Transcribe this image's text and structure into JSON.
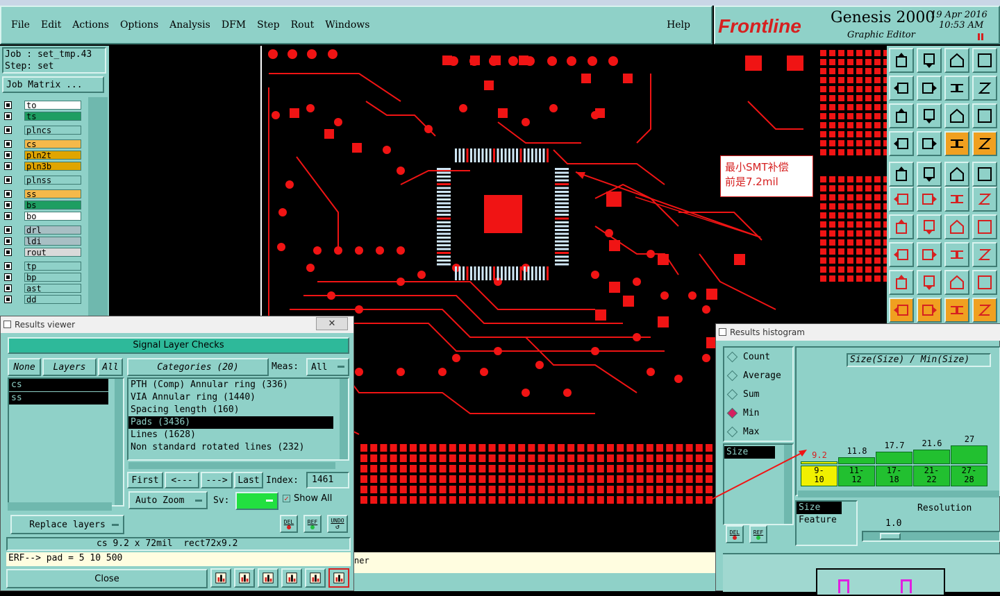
{
  "menubar": {
    "items": [
      "File",
      "Edit",
      "Actions",
      "Options",
      "Analysis",
      "DFM",
      "Step",
      "Rout",
      "Windows"
    ],
    "help": "Help"
  },
  "brand": {
    "logo": "Frontline",
    "product": "Genesis 2000",
    "subtitle": "Graphic Editor",
    "date": "19 Apr 2016",
    "time": "10:53  AM"
  },
  "job": {
    "job_label": "Job : set_tmp.43",
    "step_label": "Step: set",
    "matrix_button": "Job Matrix ..."
  },
  "layers": [
    {
      "name": "to",
      "color": "#ffffff"
    },
    {
      "name": "ts",
      "color": "#1e9e62"
    },
    {
      "name": "plncs",
      "color": "#8fd1c8"
    },
    {
      "name": "cs",
      "color": "#f5b94a"
    },
    {
      "name": "pln2t",
      "color": "#e0a500"
    },
    {
      "name": "pln3b",
      "color": "#e0a500"
    },
    {
      "name": "plnss",
      "color": "#8fd1c8"
    },
    {
      "name": "ss",
      "color": "#f5b94a"
    },
    {
      "name": "bs",
      "color": "#1e9e62"
    },
    {
      "name": "bo",
      "color": "#ffffff"
    },
    {
      "name": "drl",
      "color": "#a8bfc4"
    },
    {
      "name": "ldi",
      "color": "#a8bfc4"
    },
    {
      "name": "rout",
      "color": "#d9d9d9"
    },
    {
      "name": "tp",
      "color": "#8fd1c8"
    },
    {
      "name": "bp",
      "color": "#8fd1c8"
    },
    {
      "name": "ast",
      "color": "#8fd1c8"
    },
    {
      "name": "dd",
      "color": "#8fd1c8"
    }
  ],
  "annotation": {
    "line1": "最小SMT补偿",
    "line2": "前是7.2mil"
  },
  "results_viewer": {
    "title": "Results viewer",
    "header": "Signal Layer Checks",
    "none_btn": "None",
    "layers_btn": "Layers",
    "all_btn": "All",
    "categories_btn": "Categories (20)",
    "meas_label": "Meas:",
    "meas_value": "All",
    "layer_list": [
      "cs",
      "ss"
    ],
    "categories": [
      "PTH (Comp) Annular ring (336)",
      "VIA Annular ring (1440)",
      "Spacing length (160)",
      "Pads (3436)",
      "Lines (1628)",
      "Non standard rotated lines (232)"
    ],
    "selected_category": 3,
    "nav": {
      "first": "First",
      "prev": "<---",
      "next": "--->",
      "last": "Last",
      "index_label": "Index:",
      "index_value": "1461"
    },
    "auto_zoom": "Auto Zoom",
    "sv_label": "Sv:",
    "show_all": "Show All",
    "replace_layers": "Replace layers",
    "del": "DEL",
    "ref": "REF",
    "undo": "UNDO",
    "status": "cs 9.2 x 72mil  rect72x9.2",
    "erf": "ERF--> pad = 5 10 500",
    "close": "Close"
  },
  "histogram": {
    "title": "Results histogram",
    "options": [
      "Count",
      "Average",
      "Sum",
      "Min",
      "Max"
    ],
    "selected_option": "Min",
    "field_label": "Size(Size) / Min(Size)",
    "list_item": "Size",
    "bars": [
      {
        "value": "9.2",
        "range": "9-\n10",
        "level": 0.05,
        "highlight": true
      },
      {
        "value": "11.8",
        "range": "11-\n12",
        "level": 0.12,
        "highlight": false
      },
      {
        "value": "17.7",
        "range": "17-\n18",
        "level": 0.22,
        "highlight": false
      },
      {
        "value": "21.6",
        "range": "21-\n22",
        "level": 0.26,
        "highlight": false
      },
      {
        "value": "27",
        "range": "27-\n28",
        "level": 0.34,
        "highlight": false
      }
    ],
    "size_label": "Size",
    "feature_label": "Feature",
    "resolution_label": "Resolution",
    "resolution_value": "1.0",
    "del": "DEL",
    "ref": "REF"
  },
  "status_bar_fragment": "ner",
  "icons": [
    "layer-checkbox-icon",
    "close-icon",
    "del-icon",
    "ref-icon",
    "undo-icon",
    "dropdown-arrow-icon"
  ]
}
